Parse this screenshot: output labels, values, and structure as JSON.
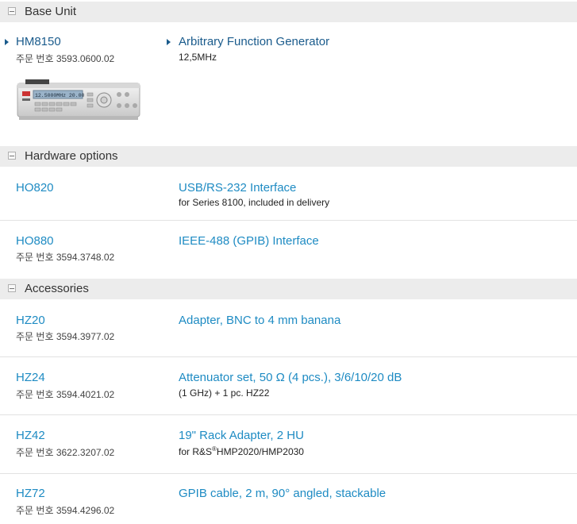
{
  "sections": {
    "base": {
      "title": "Base Unit",
      "item": {
        "code": "HM8150",
        "order": "주문 번호 3593.0600.02",
        "desc": "Arbitrary Function Generator",
        "sub": "12,5MHz",
        "display_text": "12.5000MHz  20.00"
      }
    },
    "hardware": {
      "title": "Hardware options",
      "items": [
        {
          "code": "HO820",
          "order": "",
          "desc": "USB/RS-232 Interface",
          "sub": "for Series 8100, included in delivery"
        },
        {
          "code": "HO880",
          "order": "주문 번호 3594.3748.02",
          "desc": "IEEE-488 (GPIB) Interface",
          "sub": ""
        }
      ]
    },
    "accessories": {
      "title": "Accessories",
      "items": [
        {
          "code": "HZ20",
          "order": "주문 번호 3594.3977.02",
          "desc": "Adapter, BNC to 4 mm banana",
          "sub": ""
        },
        {
          "code": "HZ24",
          "order": "주문 번호 3594.4021.02",
          "desc": "Attenuator set, 50 Ω (4 pcs.), 3/6/10/20 dB",
          "sub": "(1 GHz) + 1 pc. HZ22"
        },
        {
          "code": "HZ42",
          "order": "주문 번호 3622.3207.02",
          "desc": "19\" Rack Adapter, 2 HU",
          "sub_pre": "for R&S",
          "sub_sup": "®",
          "sub_post": "HMP2020/HMP2030"
        },
        {
          "code": "HZ72",
          "order": "주문 번호 3594.4296.02",
          "desc": "GPIB cable, 2 m, 90° angled, stackable",
          "sub": ""
        }
      ]
    }
  },
  "colors": {
    "link": "#1e8bc3",
    "link_dark": "#1a5b8c",
    "header_bg": "#ececec"
  }
}
